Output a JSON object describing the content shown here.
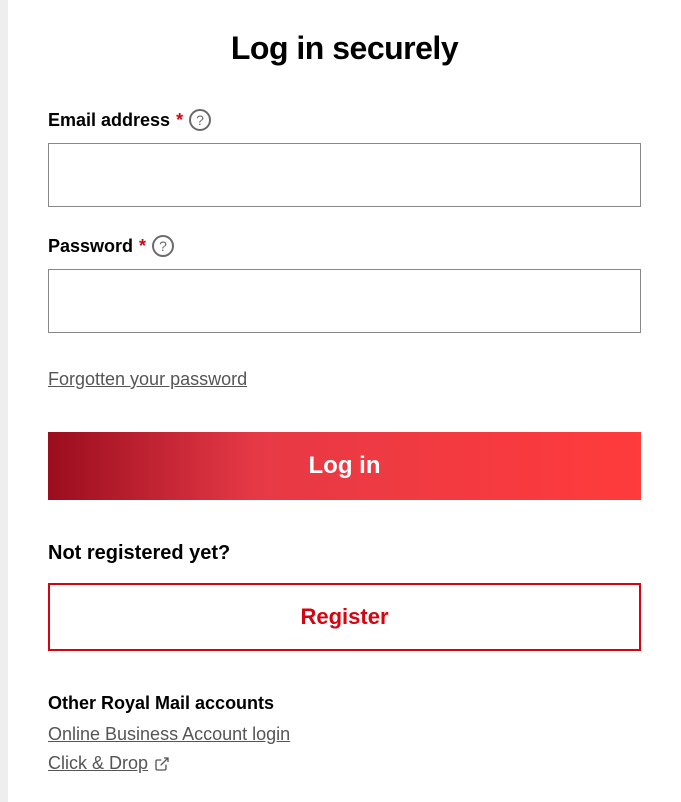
{
  "page_title": "Log in securely",
  "email": {
    "label": "Email address",
    "required_mark": "*",
    "help_mark": "?",
    "value": ""
  },
  "password": {
    "label": "Password",
    "required_mark": "*",
    "help_mark": "?",
    "value": ""
  },
  "forgot_password_text": "Forgotten your password",
  "login_button_label": "Log in",
  "not_registered_heading": "Not registered yet?",
  "register_button_label": "Register",
  "other_accounts": {
    "heading": "Other Royal Mail accounts",
    "links": [
      {
        "label": "Online Business Account login",
        "external": false
      },
      {
        "label": "Click & Drop",
        "external": true
      }
    ]
  }
}
